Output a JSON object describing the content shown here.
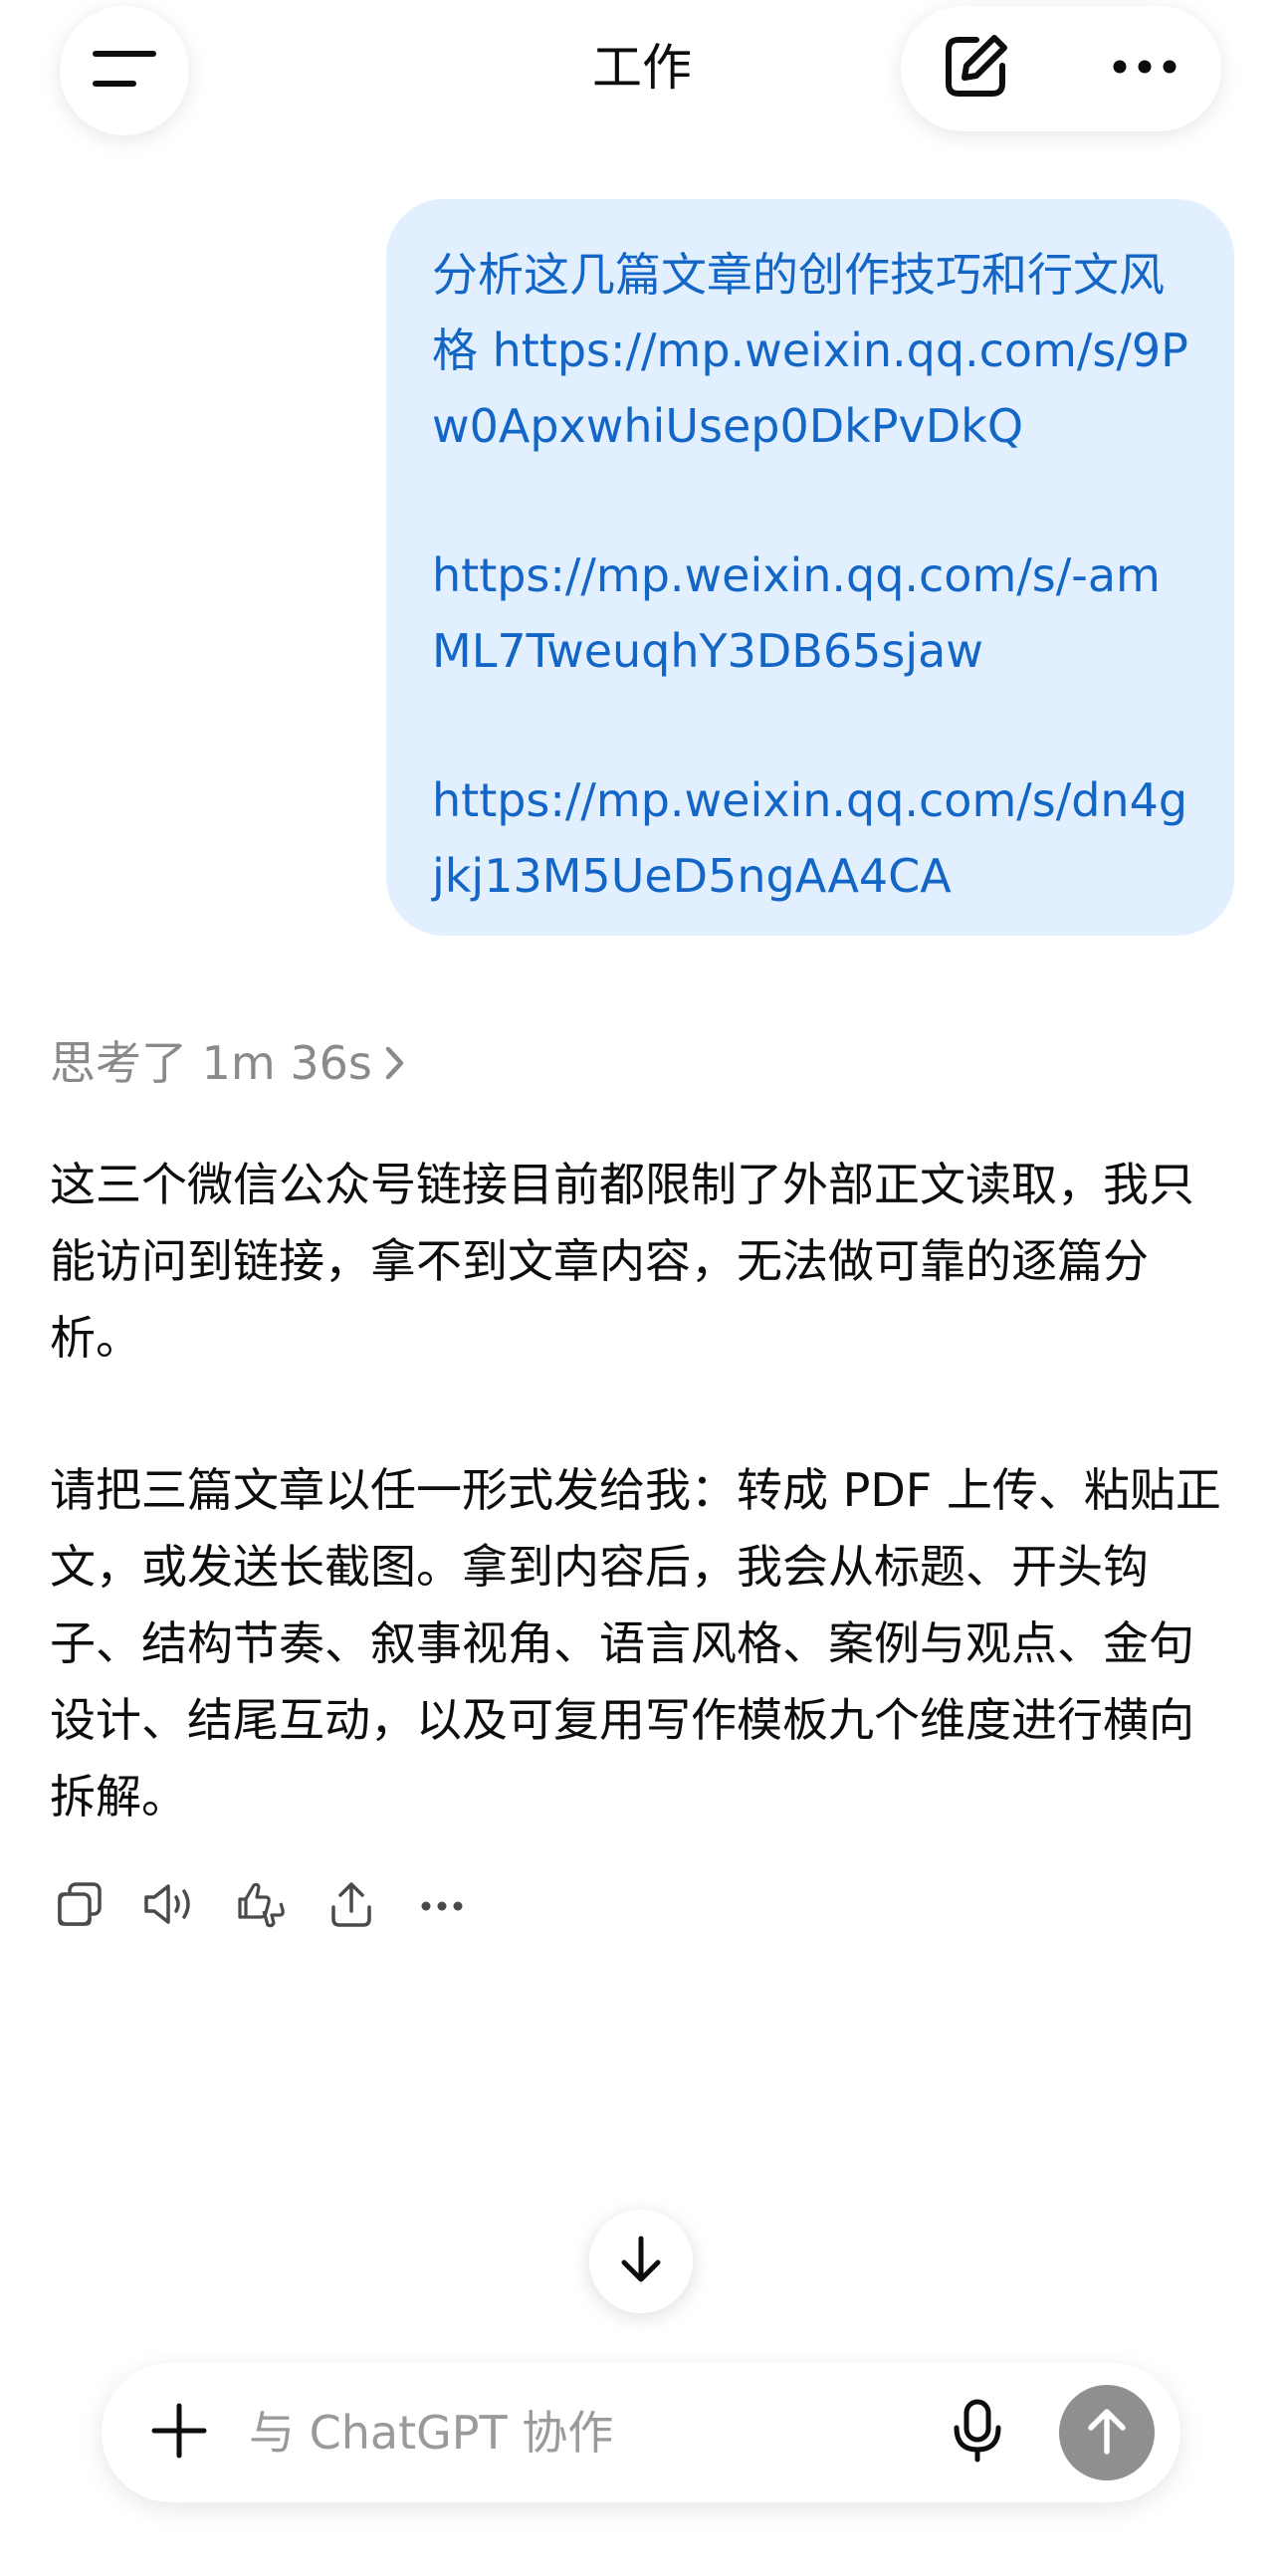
{
  "header": {
    "title": "工作",
    "menu_icon": "menu-icon",
    "new_chat_icon": "edit-icon",
    "more_icon": "more-horizontal-icon"
  },
  "user_message": {
    "paragraphs": [
      "分析这几篇文章的创作技巧和行文风格 https://mp.weixin.qq.com/s/9Pw0ApxwhiUsep0DkPvDkQ",
      "https://mp.weixin.qq.com/s/-amML7TweuqhY3DB65sjaw",
      "https://mp.weixin.qq.com/s/dn4gjkj13M5UeD5ngAA4CA"
    ]
  },
  "thinking": {
    "label": "思考了 1m 36s"
  },
  "assistant_message": {
    "paragraphs": [
      "这三个微信公众号链接目前都限制了外部正文读取，我只能访问到链接，拿不到文章内容，无法做可靠的逐篇分析。",
      "请把三篇文章以任一形式发给我：转成 PDF 上传、粘贴正文，或发送长截图。拿到内容后，我会从标题、开头钩子、结构节奏、叙事视角、语言风格、案例与观点、金句设计、结尾互动，以及可复用写作模板九个维度进行横向拆解。"
    ]
  },
  "message_actions": [
    "copy-icon",
    "read-aloud-icon",
    "feedback-icon",
    "share-icon",
    "more-icon"
  ],
  "composer": {
    "placeholder": "与 ChatGPT 协作"
  },
  "colors": {
    "user_bubble_bg": "#e1efff",
    "user_text": "#1366c6",
    "muted_text": "#8a8a8a",
    "send_button": "#8f8f8f"
  }
}
